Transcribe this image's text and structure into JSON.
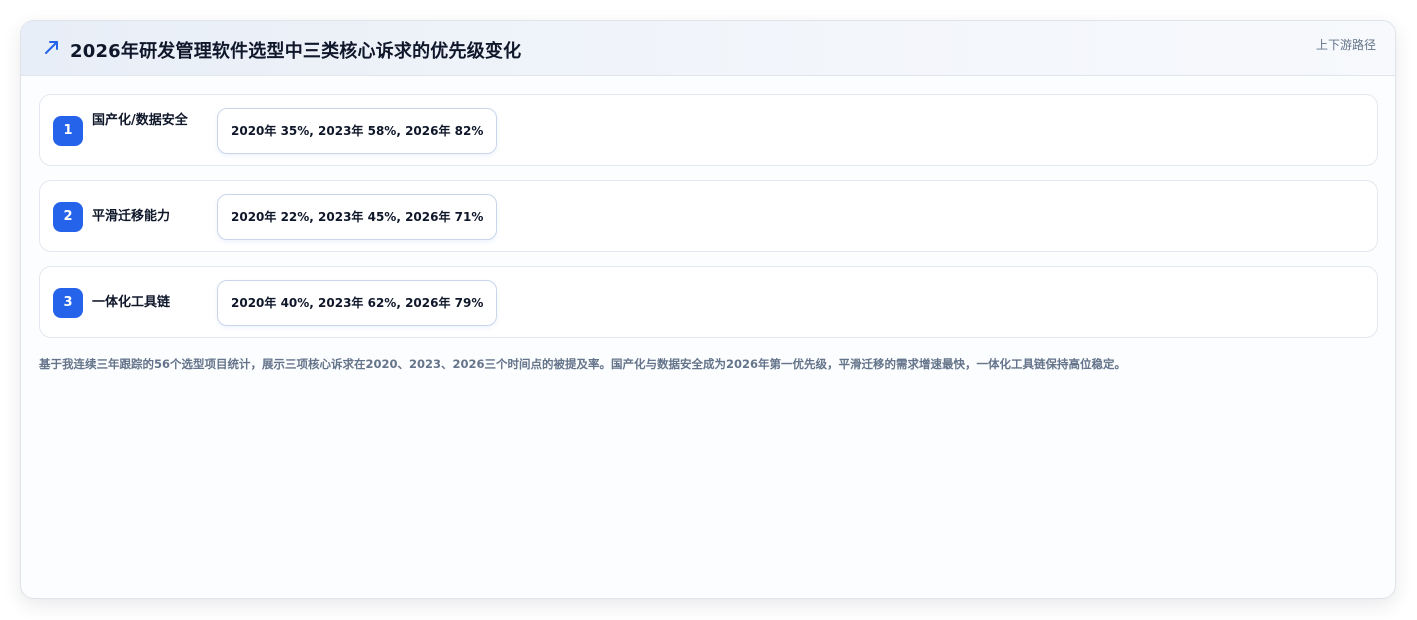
{
  "header": {
    "title": "2026年研发管理软件选型中三类核心诉求的优先级变化",
    "meta": "上下游路径",
    "icon": "trend-up-icon",
    "accent_color": "#2563eb"
  },
  "items": [
    {
      "rank": "1",
      "label": "国产化/数据安全",
      "values": "2020年 35%, 2023年 58%, 2026年 82%"
    },
    {
      "rank": "2",
      "label": "平滑迁移能力",
      "values": "2020年 22%, 2023年 45%, 2026年 71%"
    },
    {
      "rank": "3",
      "label": "一体化工具链",
      "values": "2020年 40%, 2023年 62%, 2026年 79%"
    }
  ],
  "footnote": "基于我连续三年跟踪的56个选型项目统计，展示三项核心诉求在2020、2023、2026三个时间点的被提及率。国产化与数据安全成为2026年第一优先级，平滑迁移的需求增速最快，一体化工具链保持高位稳定。"
}
